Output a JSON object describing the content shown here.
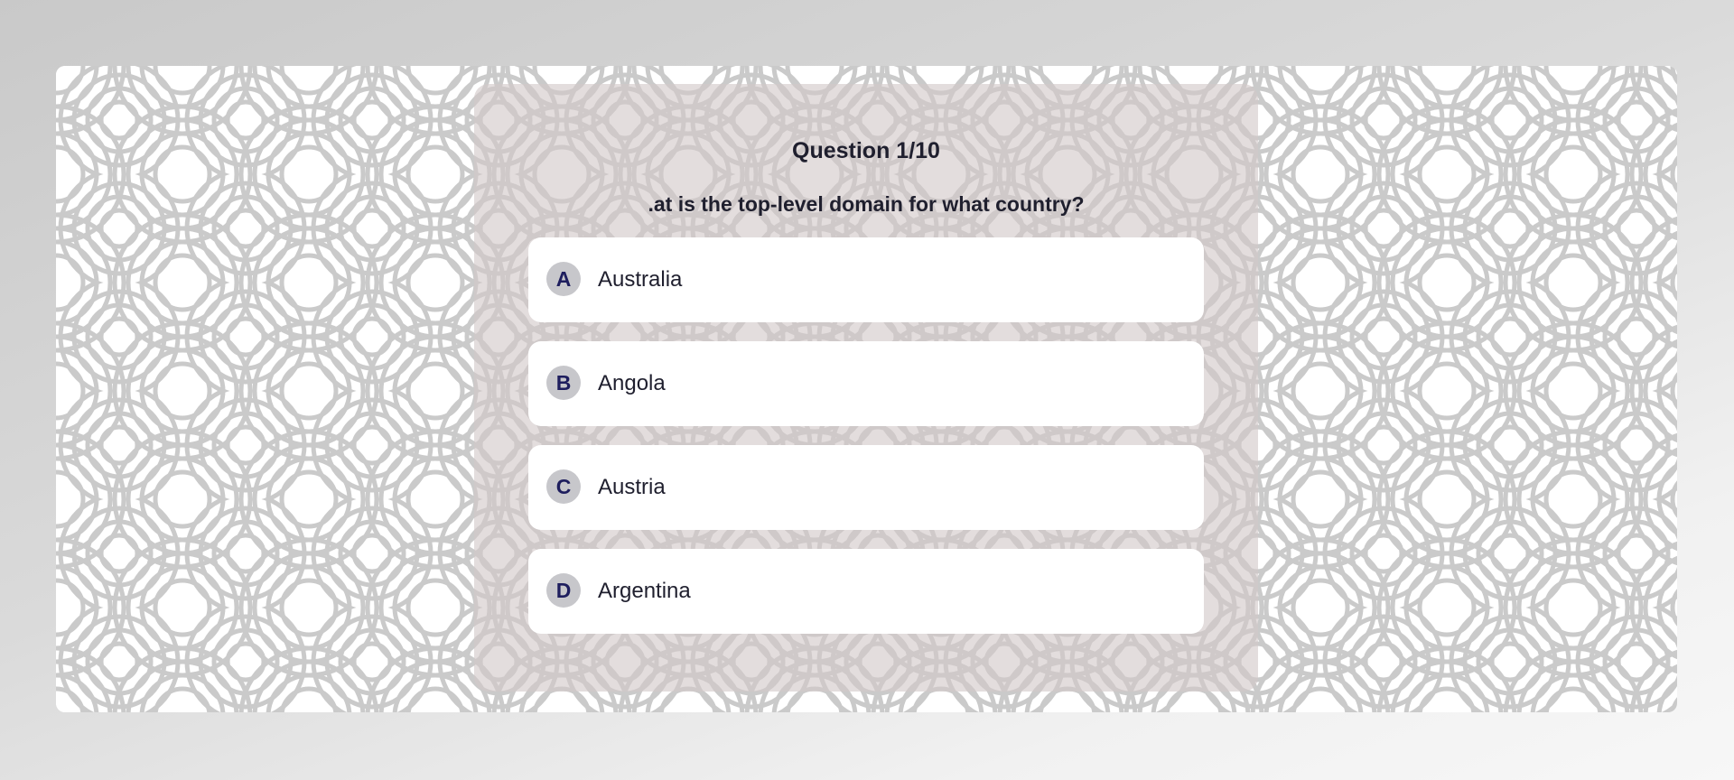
{
  "quiz": {
    "counter": "Question 1/10",
    "question": ".at is the top-level domain for what country?",
    "answers": [
      {
        "letter": "A",
        "text": "Australia"
      },
      {
        "letter": "B",
        "text": "Angola"
      },
      {
        "letter": "C",
        "text": "Austria"
      },
      {
        "letter": "D",
        "text": "Argentina"
      }
    ]
  },
  "colors": {
    "card_overlay": "#d2c8c8",
    "letter_badge": "#c7c7cb",
    "letter_text": "#1e1e5e",
    "pattern_stroke": "#cacaca"
  }
}
